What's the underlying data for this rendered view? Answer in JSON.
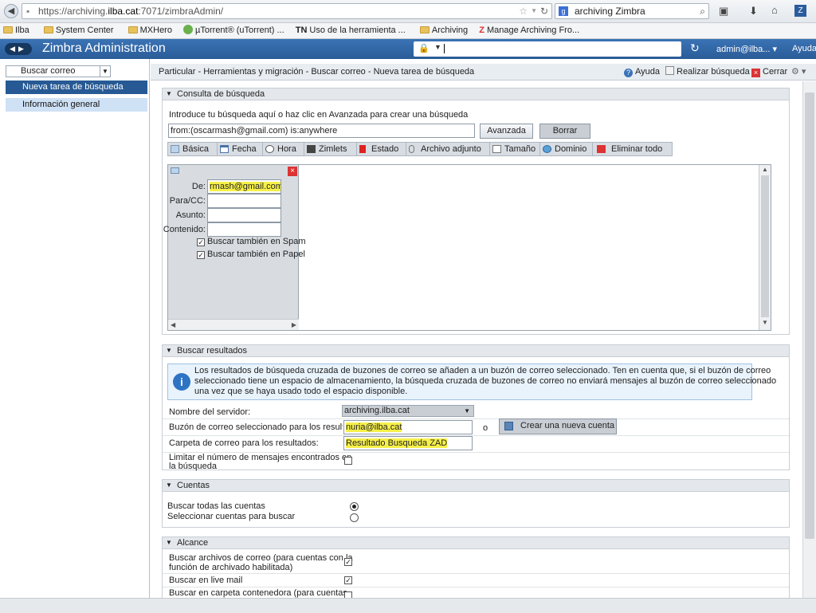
{
  "browser": {
    "url_prefix": "https://archiving.",
    "url_host": "ilba.cat",
    "url_suffix": ":7071/zimbraAdmin/",
    "search_engine_badge": "g",
    "search_text": "archiving Zimbra",
    "bookmarks": [
      "Ilba",
      "System Center",
      "MXHero",
      "µTorrent® (uTorrent) ...",
      "Uso de la herramienta ...",
      "Archiving",
      "Manage Archiving Fro..."
    ],
    "bookmark_tn": "TN",
    "bookmark_z": "Z"
  },
  "header": {
    "app_title": "Zimbra Administration",
    "admin_user": "admin@ilba...",
    "help": "Ayuda"
  },
  "sidebar": {
    "dropdown_label": "Buscar correo",
    "items": [
      {
        "label": "Nueva tarea de búsqueda"
      },
      {
        "label": "Información general"
      }
    ]
  },
  "crumbbar": {
    "path": "Particular - Herramientas y migración - Buscar correo - Nueva tarea de búsqueda",
    "help": "Ayuda",
    "run_search": "Realizar búsqueda",
    "close": "Cerrar"
  },
  "query_section": {
    "title": "Consulta de búsqueda",
    "intro": "Introduce tu búsqueda aquí o haz clic en Avanzada para crear una búsqueda",
    "query_value": "from:(oscarmash@gmail.com) is:anywhere",
    "advanced_btn": "Avanzada",
    "clear_btn": "Borrar",
    "toolbar": [
      "Básica",
      "Fecha",
      "Hora",
      "Zimlets",
      "Estado",
      "Archivo adjunto",
      "Tamaño",
      "Dominio",
      "Eliminar todo"
    ],
    "basic_form": {
      "from_label": "De:",
      "from_value": "rmash@gmail.com",
      "to_label": "Para/CC:",
      "subject_label": "Asunto:",
      "content_label": "Contenido:",
      "spam_label": "Buscar también en Spam",
      "trash_label": "Buscar también en Papel"
    }
  },
  "results_section": {
    "title": "Buscar resultados",
    "info_line1": "Los resultados de búsqueda cruzada de buzones de correo se añaden a un buzón de correo seleccionado. Ten en cuenta que, si el buzón de correo",
    "info_line2": "seleccionado tiene un espacio de almacenamiento, la búsqueda cruzada de buzones de correo no enviará mensajes al buzón de correo seleccionado",
    "info_line3": "una vez que se haya usado todo el espacio disponible.",
    "server_label": "Nombre del servidor:",
    "server_value": "archiving.ilba.cat",
    "mailbox_label": "Buzón de correo seleccionado para los resultados",
    "mailbox_value": "nuria@ilba.cat",
    "or_text": "o",
    "create_account_btn": "Crear una nueva cuenta",
    "folder_label": "Carpeta de correo para los resultados:",
    "folder_value": "Resultado Busqueda ZAD",
    "limit_label_1": "Limitar el número de mensajes encontrados en",
    "limit_label_2": "la búsqueda"
  },
  "accounts_section": {
    "title": "Cuentas",
    "all_label": "Buscar todas las cuentas",
    "select_label": "Seleccionar cuentas para buscar"
  },
  "scope_section": {
    "title": "Alcance",
    "archive_label_1": "Buscar archivos de correo (para cuentas con la",
    "archive_label_2": "función de archivado habilitada)",
    "live_label": "Buscar en live mail",
    "container_label": "Buscar en carpeta contenedora (para cuentas"
  },
  "colors": {
    "header_blue": "#2f66a6",
    "selected_nav": "#275a94",
    "highlight": "#f6f04a"
  }
}
